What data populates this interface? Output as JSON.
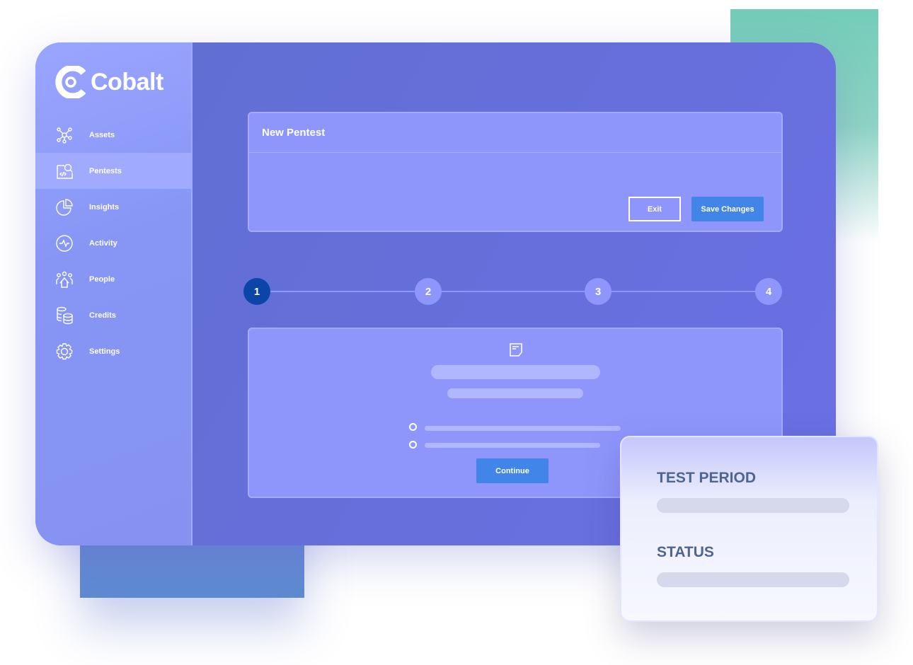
{
  "brand": {
    "name": "Cobalt"
  },
  "sidebar": {
    "items": [
      {
        "label": "Assets",
        "icon": "network-icon"
      },
      {
        "label": "Pentests",
        "icon": "code-search-icon",
        "active": true
      },
      {
        "label": "Insights",
        "icon": "pie-chart-icon"
      },
      {
        "label": "Activity",
        "icon": "pulse-icon"
      },
      {
        "label": "People",
        "icon": "people-icon"
      },
      {
        "label": "Credits",
        "icon": "coins-icon"
      },
      {
        "label": "Settings",
        "icon": "gear-icon"
      }
    ]
  },
  "header_card": {
    "title": "New Pentest",
    "exit_label": "Exit",
    "save_label": "Save Changes"
  },
  "stepper": {
    "steps": [
      "1",
      "2",
      "3",
      "4"
    ],
    "current": 1
  },
  "step_card": {
    "continue_label": "Continue"
  },
  "panel": {
    "test_period_label": "TEST PERIOD",
    "status_label": "STATUS"
  },
  "colors": {
    "primary_button": "#4285e8",
    "active_step": "#0b45a8",
    "accent_green": "#73cdb8"
  }
}
